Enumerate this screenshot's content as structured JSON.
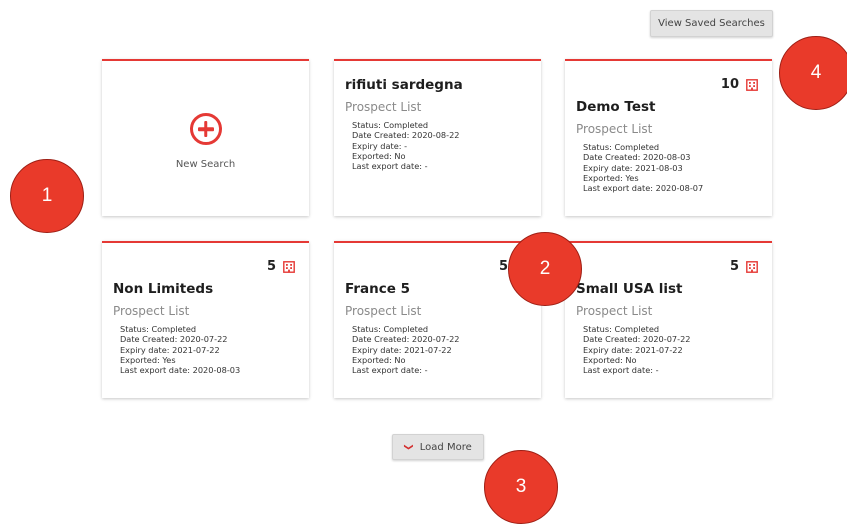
{
  "header": {
    "view_saved_label": "View Saved Searches"
  },
  "new_search": {
    "label": "New Search"
  },
  "cards": [
    {
      "count": "",
      "title": "rifiuti sardegna",
      "subtitle": "Prospect List",
      "status": "Status: Completed",
      "date_created": "Date Created: 2020-08-22",
      "expiry": "Expiry date: -",
      "exported": "Exported: No",
      "last_export": "Last export date: -"
    },
    {
      "count": "10",
      "title": "Demo Test",
      "subtitle": "Prospect List",
      "status": "Status: Completed",
      "date_created": "Date Created: 2020-08-03",
      "expiry": "Expiry date: 2021-08-03",
      "exported": "Exported: Yes",
      "last_export": "Last export date: 2020-08-07"
    },
    {
      "count": "5",
      "title": "Non Limiteds",
      "subtitle": "Prospect List",
      "status": "Status: Completed",
      "date_created": "Date Created: 2020-07-22",
      "expiry": "Expiry date: 2021-07-22",
      "exported": "Exported: Yes",
      "last_export": "Last export date: 2020-08-03"
    },
    {
      "count": "5",
      "title": "France 5",
      "subtitle": "Prospect List",
      "status": "Status: Completed",
      "date_created": "Date Created: 2020-07-22",
      "expiry": "Expiry date: 2021-07-22",
      "exported": "Exported: No",
      "last_export": "Last export date: -"
    },
    {
      "count": "5",
      "title": "Small USA list",
      "subtitle": "Prospect List",
      "status": "Status: Completed",
      "date_created": "Date Created: 2020-07-22",
      "expiry": "Expiry date: 2021-07-22",
      "exported": "Exported: No",
      "last_export": "Last export date: -"
    }
  ],
  "load_more": {
    "label": "Load More",
    "icon": "chevron-down-icon"
  },
  "annotations": [
    "1",
    "2",
    "3",
    "4"
  ],
  "colors": {
    "accent": "#e53935",
    "annotation": "#e93a2a"
  },
  "icons": {
    "new_search": "plus-circle-icon",
    "count": "building-icon"
  }
}
